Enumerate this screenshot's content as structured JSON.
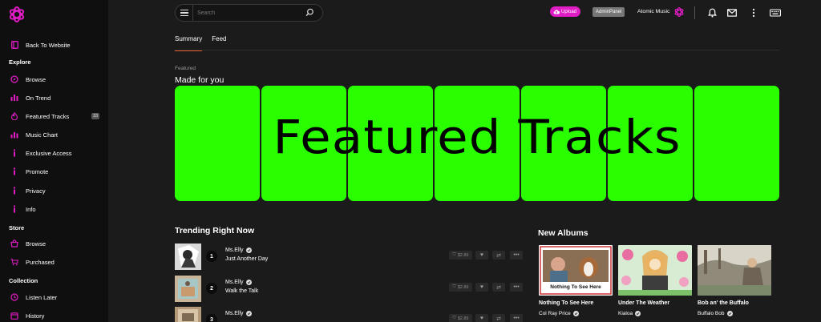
{
  "sidebar": {
    "back": "Back To Website",
    "explore_header": "Explore",
    "explore": [
      {
        "label": "Browse",
        "icon": "compass-icon"
      },
      {
        "label": "On Trend",
        "icon": "bars-icon"
      },
      {
        "label": "Featured Tracks",
        "icon": "fire-icon",
        "badge": "33"
      },
      {
        "label": "Music Chart",
        "icon": "chart-icon"
      },
      {
        "label": "Exclusive Access",
        "icon": "info-icon"
      },
      {
        "label": "Promote",
        "icon": "info-icon"
      },
      {
        "label": "Privacy",
        "icon": "info-icon"
      },
      {
        "label": "Info",
        "icon": "info-icon"
      }
    ],
    "store_header": "Store",
    "store": [
      {
        "label": "Browse",
        "icon": "bag-icon"
      },
      {
        "label": "Purchased",
        "icon": "cart-icon"
      }
    ],
    "collection_header": "Collection",
    "collection": [
      {
        "label": "Listen Later",
        "icon": "clock-icon"
      },
      {
        "label": "History",
        "icon": "calendar-icon"
      }
    ]
  },
  "topbar": {
    "search_placeholder": "Search",
    "upload": "Upload",
    "admin": "AdminPanel",
    "user": "Atomic Music"
  },
  "tabs": [
    "Summary",
    "Feed"
  ],
  "featured": {
    "kicker": "Featured",
    "title": "Made for you",
    "banner_text": "Featured Tracks"
  },
  "trending": {
    "title": "Trending Right Now",
    "tracks": [
      {
        "rank": "1",
        "artist": "Ms.Elly",
        "title": "Just Another Day",
        "price": "$2.89"
      },
      {
        "rank": "2",
        "artist": "Ms.Elly",
        "title": "Walk the Talk",
        "price": "$2.89"
      },
      {
        "rank": "3",
        "artist": "Ms.Elly",
        "title": "",
        "price": "$2.89"
      }
    ]
  },
  "albums": {
    "title": "New Albums",
    "items": [
      {
        "title": "Nothing To See Here",
        "artist": "Col Ray Price",
        "art_caption": "Nothing To See Here"
      },
      {
        "title": "Under The Weather",
        "artist": "Kialoa"
      },
      {
        "title": "Bob an' the Buffalo",
        "artist": "Buffalo Bob"
      }
    ]
  },
  "colors": {
    "accent": "#e01cc4",
    "banner_green": "#2aff00",
    "tab_underline": "#e45a2a"
  }
}
